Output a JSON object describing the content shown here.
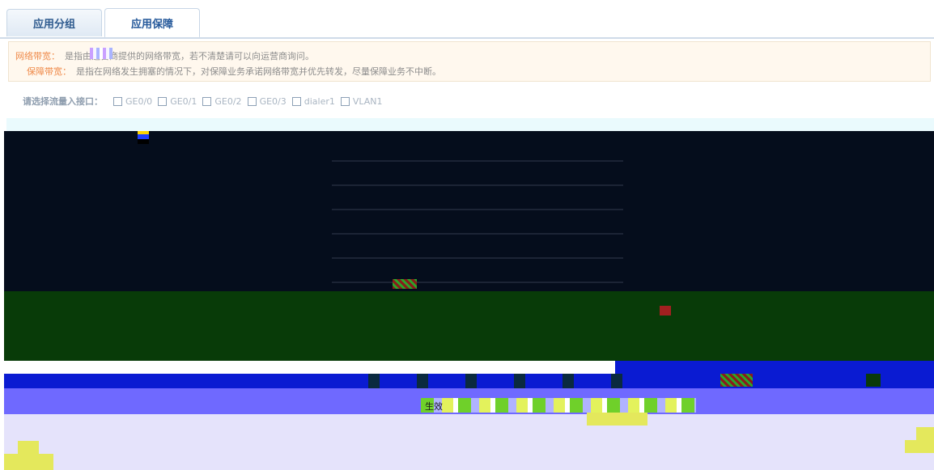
{
  "tabs": [
    {
      "label": "应用分组",
      "active": false
    },
    {
      "label": "应用保障",
      "active": true
    }
  ],
  "notice": {
    "line1_key": "网络带宽：",
    "line1_desc": "是指由运营商提供的网络带宽，若不清楚请可以向运营商询问。",
    "line2_key": "保障带宽：",
    "line2_desc": "是指在网络发生拥塞的情况下，对保障业务承诺网络带宽并优先转发，尽量保障业务不中断。"
  },
  "interfaces": {
    "label": "请选择流量入接口：",
    "options": [
      "GE0/0",
      "GE0/1",
      "GE0/2",
      "GE0/3",
      "dialer1",
      "VLAN1"
    ]
  },
  "status": {
    "text": "生效"
  },
  "colors": {
    "tab_text": "#2d5a8e",
    "notice_key": "#ef8a4a",
    "notice_bg": "#fff8ee"
  }
}
